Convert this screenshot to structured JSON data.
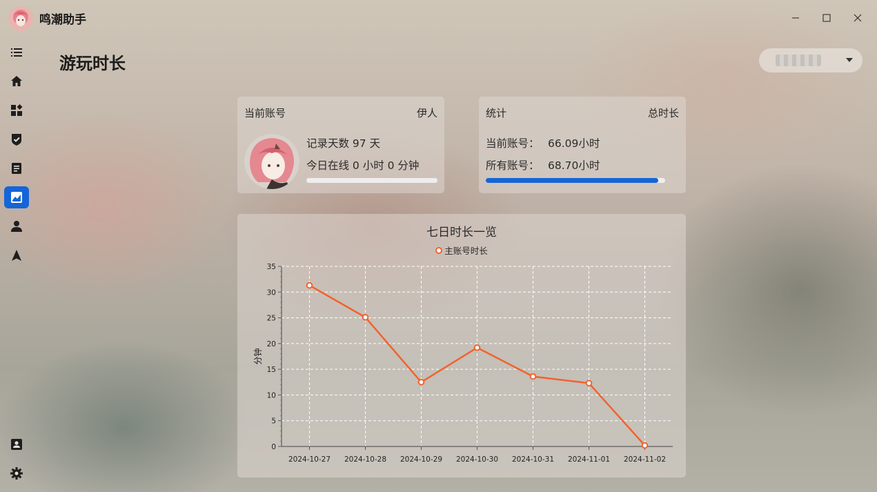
{
  "app": {
    "title": "鸣潮助手",
    "logo_icon": "avatar-logo"
  },
  "window_controls": {
    "minimize_icon": "minimize-icon",
    "maximize_icon": "maximize-icon",
    "close_icon": "close-icon"
  },
  "sidebar": {
    "items": [
      {
        "icon": "menu-list-icon",
        "active": false
      },
      {
        "icon": "home-icon",
        "active": false
      },
      {
        "icon": "widgets-icon",
        "active": false
      },
      {
        "icon": "check-shield-icon",
        "active": false
      },
      {
        "icon": "article-icon",
        "active": false
      },
      {
        "icon": "chart-image-icon",
        "active": true
      },
      {
        "icon": "person-icon",
        "active": false
      },
      {
        "icon": "navigation-icon",
        "active": false
      }
    ],
    "bottom_items": [
      {
        "icon": "contact-card-icon"
      },
      {
        "icon": "settings-gear-icon"
      }
    ],
    "accent": "#1565d8"
  },
  "page": {
    "title": "游玩时长"
  },
  "account_select": {
    "value_redacted": true
  },
  "account_card": {
    "label": "当前账号",
    "name": "伊人",
    "record_days": "记录天数 97 天",
    "today_online": "今日在线 0 小时 0 分钟",
    "today_progress": 0
  },
  "stats_card": {
    "label": "统计",
    "right_label": "总时长",
    "current_label": "当前账号：",
    "current_value": "66.09小时",
    "all_label": "所有账号：",
    "all_value": "68.70小时",
    "progress": 0.962
  },
  "chart_data": {
    "type": "line",
    "title": "七日时长一览",
    "ylabel": "分钟",
    "xlabel": "",
    "categories": [
      "2024-10-27",
      "2024-10-28",
      "2024-10-29",
      "2024-10-30",
      "2024-10-31",
      "2024-11-01",
      "2024-11-02"
    ],
    "series": [
      {
        "name": "主账号时长",
        "values": [
          31.3,
          25.1,
          12.5,
          19.2,
          13.6,
          12.3,
          0.2
        ],
        "color": "#f2622e"
      }
    ],
    "ylim": [
      0,
      35
    ],
    "yticks": [
      0,
      5,
      10,
      15,
      20,
      25,
      30,
      35
    ],
    "grid": true,
    "legend_position": "top"
  }
}
